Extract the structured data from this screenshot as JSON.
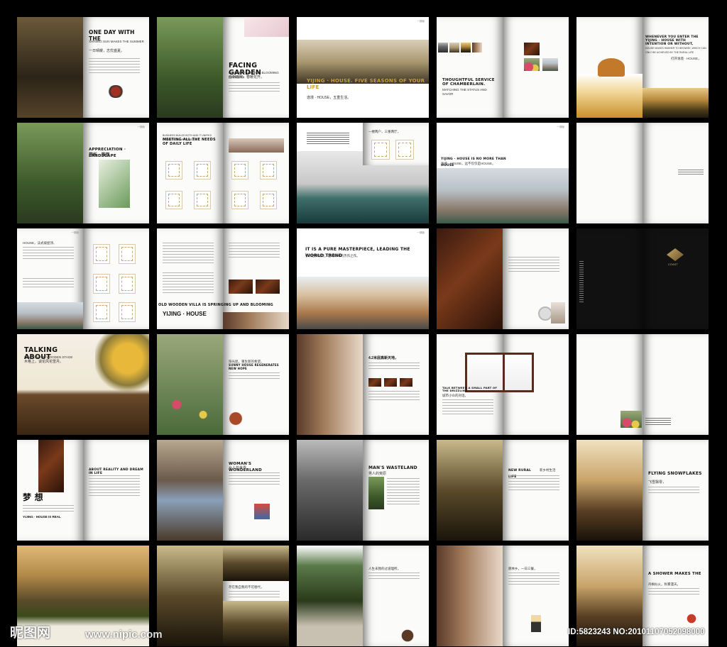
{
  "header_mark": "一期版",
  "spreads": [
    {
      "title": "ONE DAY WITH THE",
      "caption": "SHINING SUN MAKES THE SUMMER",
      "subtitle": "一日晴暖，志优盛夏。"
    },
    {
      "title": "FACING GARDEN",
      "caption": "BLOOM SPRING AND BLOOMING FLOWERS",
      "subtitle": "面朝庭院，春暖花开。"
    },
    {
      "title": "YIJING · HOUSE. FIVE SEASONS OF YOUR LIFE",
      "caption": "",
      "subtitle": "逸境 · HOUSE，五重生活。"
    },
    {
      "title": "THOUGHTFUL SERVICE OF CHAMBERLAIN.",
      "caption": "MATCHING THE STATUS AND SAVOR",
      "subtitle": ""
    },
    {
      "title": "WHENEVER YOU ENTER THE YIJING · HOUSE WITH INTENTION OR WITHOUT,",
      "caption": "HOUSE MAKES HIM/HER TO BROWSE, WHICH CAN ONLY BE ACHIEVED BY THE RURAL LIFE",
      "subtitle": "打开逸境 · HOUSE，"
    },
    {
      "title": "APPRECIATION · LANDSCAPE",
      "caption": "",
      "subtitle": "赏析 · 景观"
    },
    {
      "title": "MEETING ALL THE NEEDS OF DAILY LIFE",
      "caption": "BUSINESS BUILDS BOTH AND IT UNIFIES COMMERCIAL APPROPRIATE",
      "subtitle": ""
    },
    {
      "title": "",
      "caption": "",
      "subtitle": "一楼两户，三重两厅，"
    },
    {
      "title": "YIJING · HOUSE IS NO MORE THAN HOUSE",
      "caption": "",
      "subtitle": "逸境 · HOUSE，远不仅仅是HOUSE。"
    },
    {
      "title": "",
      "caption": "",
      "subtitle": ""
    },
    {
      "title": "",
      "caption": "",
      "subtitle": "HOUSE，法式坡屋顶、"
    },
    {
      "title": "OLD WOODEN VILLA IS SPRINGING UP AND BLOOMING",
      "caption": "",
      "subtitle": "YIJING · HOUSE"
    },
    {
      "title": "IT IS A PURE MASTERPIECE, LEADING THE WORLD TREND",
      "caption": "",
      "subtitle": "引领世界潮流，是纯粹中的杰作之作。"
    },
    {
      "title": "",
      "caption": "",
      "subtitle": ""
    },
    {
      "title": "",
      "caption": "",
      "subtitle": "COAST"
    },
    {
      "title": "TALKING ABOUT",
      "caption": "LOVE ON THE WOODEN STAGE",
      "subtitle": "木格上，谈论风花雪月。"
    },
    {
      "title": "SUNNY HOUSE REGENERATES NEW HOPE",
      "caption": "",
      "subtitle": "阳光屋，重生新的希望。"
    },
    {
      "title": "",
      "caption": "",
      "subtitle": "4.2米层高新天地，"
    },
    {
      "title": "TALK BETWEEN A SMALL PART OF THE DRIZZLING",
      "caption": "",
      "subtitle": "城市小众的对话。"
    },
    {
      "title": "",
      "caption": "",
      "subtitle": ""
    },
    {
      "title": "梦 想",
      "caption": "ABOUT REALITY AND DREAM IN LIFE",
      "subtitle": "YIJING · HOUSE IS REAL"
    },
    {
      "title": "WOMAN'S WONDERLAND",
      "caption": "",
      "subtitle": "女人的世界"
    },
    {
      "title": "MAN'S WASTELAND",
      "caption": "",
      "subtitle": "男人的荒原"
    },
    {
      "title": "NEW RURAL LIFE",
      "caption": "",
      "subtitle": "新乡村生活"
    },
    {
      "title": "FLYING SNOWFLAKES",
      "caption": "",
      "subtitle": "飞雪飘零，"
    },
    {
      "title": "",
      "caption": "",
      "subtitle": ""
    },
    {
      "title": "",
      "caption": "",
      "subtitle": "存在我自我的不可替代，"
    },
    {
      "title": "",
      "caption": "",
      "subtitle": "人生未我的过道理所，"
    },
    {
      "title": "",
      "caption": "",
      "subtitle": "愿林乡，一日三餐，"
    },
    {
      "title": "A SHOWER MAKES THE",
      "caption": "",
      "subtitle": "丹枫似火，秋雾漫天。"
    }
  ],
  "watermark": {
    "logo": "昵图网",
    "url": "www.nipic.com",
    "id": "ID:5823243 NO:20101107052098000"
  },
  "colors": {
    "background": "#000000",
    "page": "#fbfbfa",
    "ink": "#111111"
  }
}
